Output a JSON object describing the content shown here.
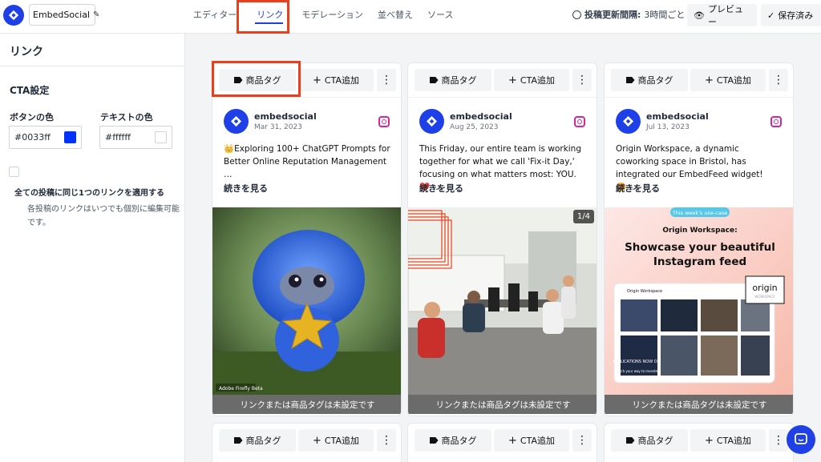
{
  "header": {
    "project_name": "EmbedSocial",
    "tabs": [
      {
        "label": "エディター"
      },
      {
        "label": "リンク"
      },
      {
        "label": "モデレーション"
      },
      {
        "label": "並べ替え"
      },
      {
        "label": "ソース"
      }
    ],
    "status_label": "投稿更新間隔:",
    "status_value": "3時間ごと",
    "preview_label": "プレビュー",
    "saved_label": "保存済み"
  },
  "sidebar": {
    "title": "リンク",
    "cta_heading": "CTA設定",
    "button_color_label": "ボタンの色",
    "button_color_value": "#0033ff",
    "text_color_label": "テキストの色",
    "text_color_value": "#ffffff",
    "apply_all_label": "全ての投稿に同じ1つのリンクを適用する",
    "apply_all_desc": "各投稿のリンクはいつでも個別に編集可能です。"
  },
  "card_actions": {
    "tag_label": "商品タグ",
    "cta_label": "CTA追加",
    "no_link": "リンクまたは商品タグは未設定です",
    "read_more": "続きを見る"
  },
  "cards": [
    {
      "author": "embedsocial",
      "date": "Mar 31, 2023",
      "caption": "👑Exploring 100+ ChatGPT Prompts for Better Online Reputation Management …",
      "media_label": "Adobe Firefly Beta"
    },
    {
      "author": "embedsocial",
      "date": "Aug 25, 2023",
      "caption": "This Friday, our entire team is working together for what we call 'Fix-it Day,' focusing on what matters most: YOU. ❤️…",
      "counter": "1/4"
    },
    {
      "author": "embedsocial",
      "date": "Jul 13, 2023",
      "caption": "Origin Workspace, a dynamic coworking space in Bristol, has integrated our EmbedFeed widget! 🤩…",
      "poster": {
        "pill": "This week's use-case",
        "subtitle": "Origin Workspace:",
        "headline": "Showcase your beautiful Instagram feed",
        "brand": "origin",
        "brand_sub": "WORKSPACE",
        "screen_title": "Origin Workspace",
        "screen_tile": "APPLICATIONS NOW OPEN",
        "screen_caption": "#Pitch your way to investment"
      }
    }
  ],
  "colors": {
    "accent": "#1e40e6",
    "highlight": "#e8401c",
    "button_color": "#0033ff",
    "text_color": "#ffffff"
  }
}
